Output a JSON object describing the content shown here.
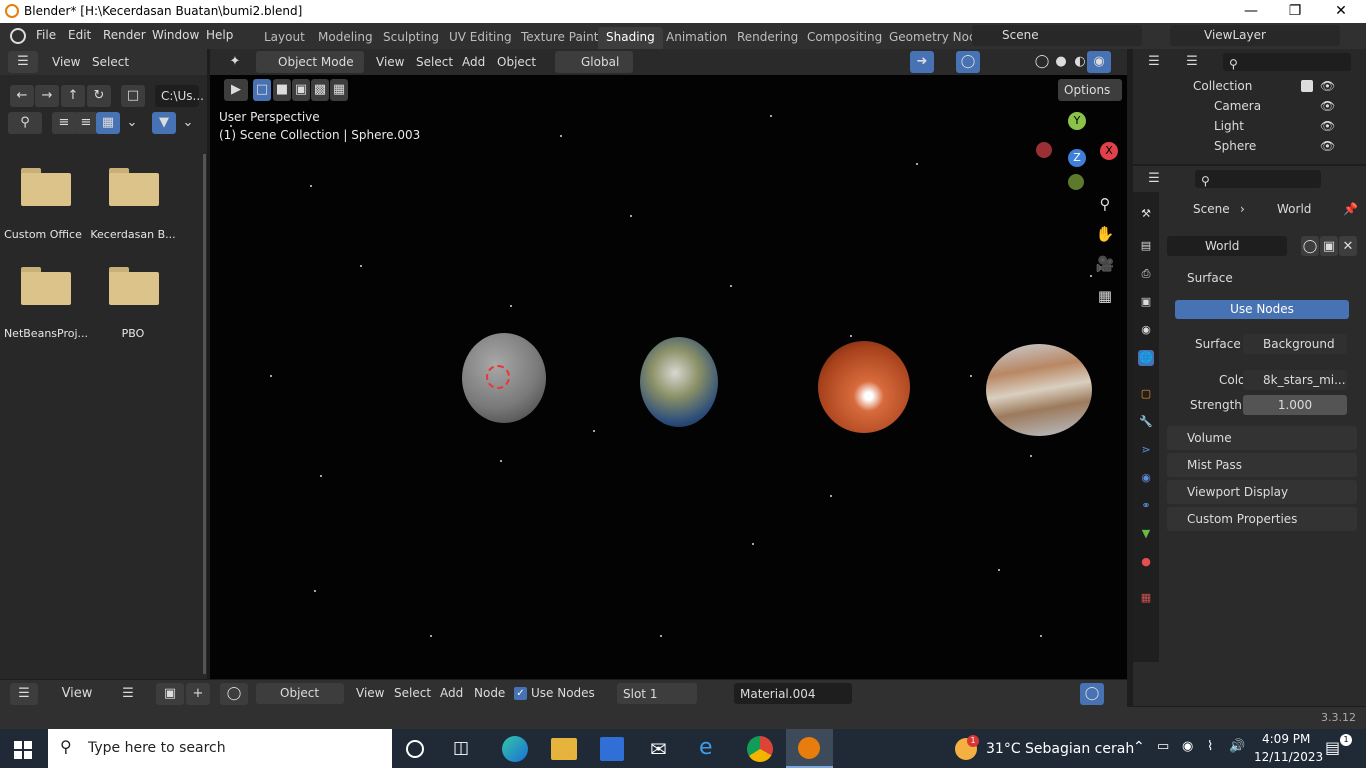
{
  "window": {
    "title": "Blender* [H:\\Kecerdasan Buatan\\bumi2.blend]"
  },
  "menubar": {
    "items": [
      "File",
      "Edit",
      "Render",
      "Window",
      "Help"
    ],
    "workspaces": [
      "Layout",
      "Modeling",
      "Sculpting",
      "UV Editing",
      "Texture Paint",
      "Shading",
      "Animation",
      "Rendering",
      "Compositing",
      "Geometry Noc"
    ],
    "active_workspace": "Shading",
    "scene": "Scene",
    "view_layer": "ViewLayer"
  },
  "file_browser": {
    "menus": [
      "View",
      "Select"
    ],
    "path": "C:\\Us...",
    "folders": [
      "Custom Office",
      "Kecerdasan B...",
      "NetBeansProj...",
      "PBO"
    ]
  },
  "viewport": {
    "mode": "Object Mode",
    "menus": [
      "View",
      "Select",
      "Add",
      "Object"
    ],
    "transform": "Global",
    "options": "Options",
    "perspective": "User Perspective",
    "collection": "(1) Scene Collection | Sphere.003",
    "gizmo": {
      "y": "Y",
      "z": "Z",
      "x": "X"
    }
  },
  "outliner": {
    "items": [
      "Collection",
      "Camera",
      "Light",
      "Sphere"
    ]
  },
  "properties": {
    "breadcrumb_scene": "Scene",
    "breadcrumb_world": "World",
    "world_name": "World",
    "surface_section": "Surface",
    "use_nodes": "Use Nodes",
    "surface_label": "Surface",
    "surface_value": "Background",
    "color_label": "Color",
    "color_value": "8k_stars_mi...",
    "strength_label": "Strength",
    "strength_value": "1.000",
    "sections": [
      "Volume",
      "Mist Pass",
      "Viewport Display",
      "Custom Properties"
    ]
  },
  "node_editor_header": {
    "object_label": "Object",
    "menus": [
      "View",
      "Select",
      "Add",
      "Node"
    ],
    "use_nodes": "Use Nodes",
    "slot": "Slot 1",
    "material": "Material.004"
  },
  "file_browser_footer": {
    "view": "View"
  },
  "statusbar": {
    "version": "3.3.12"
  },
  "taskbar": {
    "search_placeholder": "Type here to search",
    "weather": "31°C  Sebagian cerah",
    "time": "4:09 PM",
    "date": "12/11/2023",
    "notification_count": "1"
  },
  "colors": {
    "accent": "#4772b3",
    "blender_orange": "#e87d0d",
    "panel_bg": "#303030"
  }
}
